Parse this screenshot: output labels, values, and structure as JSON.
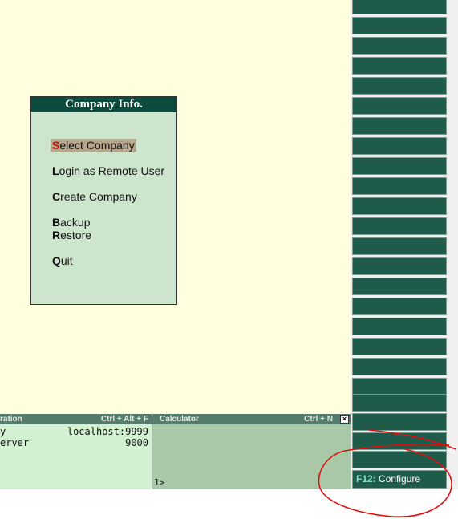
{
  "company_panel": {
    "title": "Company Info.",
    "items": [
      {
        "hotkey": "S",
        "rest": "elect Company"
      },
      {
        "hotkey": "L",
        "rest": "ogin as Remote User"
      },
      {
        "hotkey": "C",
        "rest": "reate Company"
      },
      {
        "hotkey": "B",
        "rest": "ackup"
      },
      {
        "hotkey": "R",
        "rest": "estore"
      },
      {
        "hotkey": "Q",
        "rest": "uit"
      }
    ]
  },
  "calc_left": {
    "header_left": "ration",
    "header_right": "Ctrl + Alt + F",
    "row1_label": "y",
    "row1_value": "localhost:9999",
    "row2_label": "erver",
    "row2_value": "9000"
  },
  "calculator": {
    "header_left": "Calculator",
    "header_right": "Ctrl + N",
    "close": "×",
    "prompt": "1>"
  },
  "right_bar": {
    "f12_key": "F12:",
    "f12_label": "Configure"
  },
  "colors": {
    "main_bg": "#ffffe0",
    "panel_bg": "#cce5cc",
    "title_bg": "#0d4a3e",
    "button_bg": "#1e5b4b",
    "highlight": "#b5a58a",
    "hotkey_selected": "#d01010",
    "annotation": "#e01010"
  }
}
